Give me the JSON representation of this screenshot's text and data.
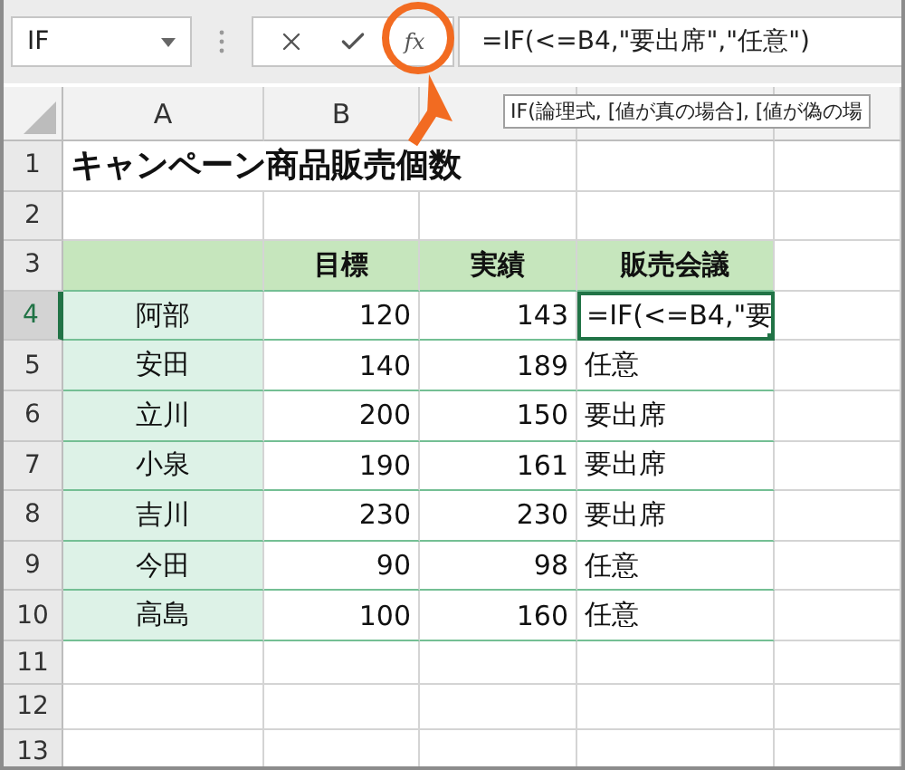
{
  "name_box": {
    "value": "IF"
  },
  "formula_bar": {
    "fx_label": "fx",
    "value": "=IF(<=B4,\"要出席\",\"任意\")"
  },
  "tooltip": "IF(論理式, [値が真の場合], [値が偽の場",
  "columns": [
    {
      "label": "A",
      "selected": false
    },
    {
      "label": "B",
      "selected": false
    }
  ],
  "row_numbers": [
    {
      "label": "1",
      "selected": false
    },
    {
      "label": "2",
      "selected": false
    },
    {
      "label": "3",
      "selected": false
    },
    {
      "label": "4",
      "selected": true
    },
    {
      "label": "5",
      "selected": false
    },
    {
      "label": "6",
      "selected": false
    },
    {
      "label": "7",
      "selected": false
    },
    {
      "label": "8",
      "selected": false
    },
    {
      "label": "9",
      "selected": false
    },
    {
      "label": "10",
      "selected": false
    },
    {
      "label": "11",
      "selected": false
    },
    {
      "label": "12",
      "selected": false
    },
    {
      "label": "13",
      "selected": false
    }
  ],
  "title": "キャンペーン商品販売個数",
  "table": {
    "columns": [
      "目標",
      "実績",
      "販売会議"
    ],
    "rows": [
      {
        "name": "阿部",
        "target": "120",
        "actual": "143",
        "meeting": "=IF(<=B4,\"要",
        "active": true
      },
      {
        "name": "安田",
        "target": "140",
        "actual": "189",
        "meeting": "任意",
        "active": false
      },
      {
        "name": "立川",
        "target": "200",
        "actual": "150",
        "meeting": "要出席",
        "active": false
      },
      {
        "name": "小泉",
        "target": "190",
        "actual": "161",
        "meeting": "要出席",
        "active": false
      },
      {
        "name": "吉川",
        "target": "230",
        "actual": "230",
        "meeting": "要出席",
        "active": false
      },
      {
        "name": "今田",
        "target": "90",
        "actual": "98",
        "meeting": "任意",
        "active": false
      },
      {
        "name": "高島",
        "target": "100",
        "actual": "160",
        "meeting": "任意",
        "active": false
      }
    ]
  }
}
